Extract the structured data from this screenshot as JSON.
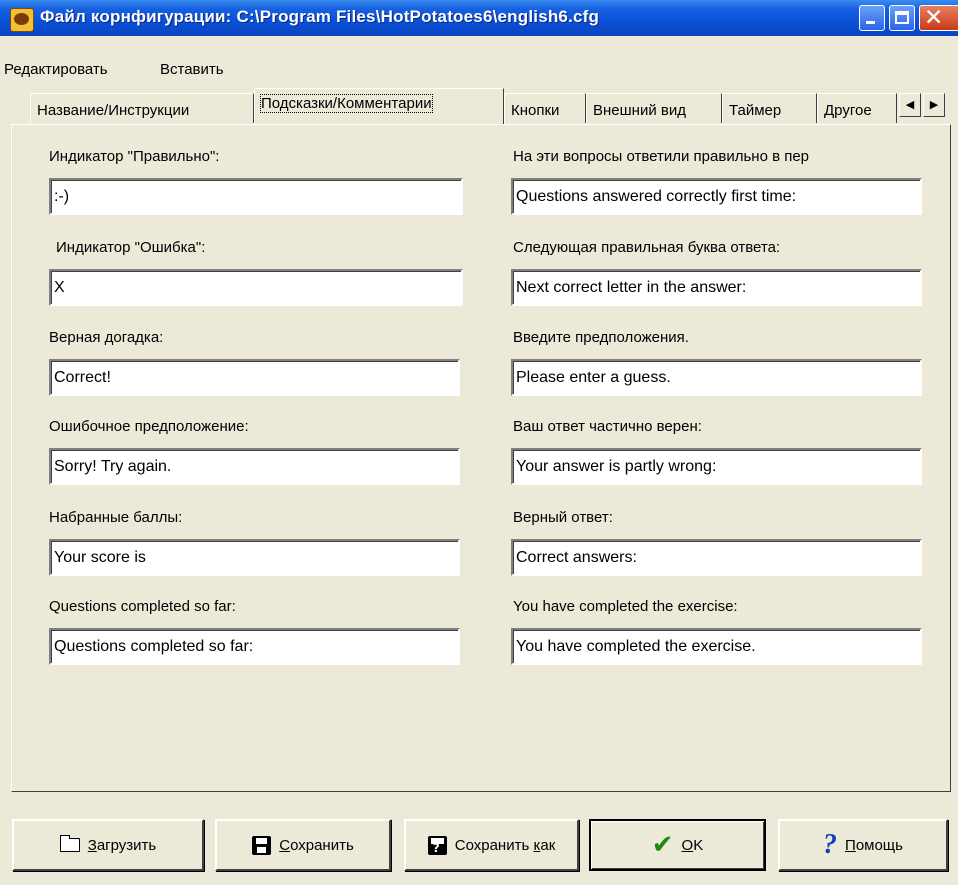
{
  "window": {
    "title": "Файл корнфигурации: C:\\Program Files\\HotPotatoes6\\english6.cfg"
  },
  "menu": {
    "items": [
      "Редактировать",
      "Вставить"
    ]
  },
  "tabs": [
    {
      "label": "Название/Инструкции",
      "active": false
    },
    {
      "label": "Подсказки/Комментарии",
      "active": true
    },
    {
      "label": "Кнопки",
      "active": false
    },
    {
      "label": "Внешний вид",
      "active": false
    },
    {
      "label": "Таймер",
      "active": false
    },
    {
      "label": "Другое",
      "active": false
    }
  ],
  "tab_scroll": {
    "left": "◀",
    "right": "▶"
  },
  "fields": {
    "correct_indicator": {
      "label": "Индикатор \"Правильно\":",
      "value": ":-)"
    },
    "error_indicator": {
      "label": "Индикатор \"Ошибка\":",
      "value": "X"
    },
    "correct_guess": {
      "label": "Верная догадка:",
      "value": "Correct!"
    },
    "wrong_guess": {
      "label": "Ошибочное предположение:",
      "value": "Sorry! Try again."
    },
    "score": {
      "label": "Набранные баллы:",
      "value": "Your score is"
    },
    "questions_completed": {
      "label": "Questions completed so far:",
      "value": "Questions completed so far:"
    },
    "first_time_correct": {
      "label": "На эти вопросы ответили правильно в пер",
      "value": "Questions answered correctly first time:"
    },
    "next_letter": {
      "label": "Следующая правильная буква ответа:",
      "value": "Next correct letter in the answer:"
    },
    "enter_guess": {
      "label": "Введите предположения.",
      "value": "Please enter a guess."
    },
    "partly_correct": {
      "label": "Ваш ответ частично верен:",
      "value": "Your answer is partly wrong:"
    },
    "correct_answer": {
      "label": "Верный ответ:",
      "value": "Correct answers:"
    },
    "exercise_completed": {
      "label": "You have completed the exercise:",
      "value": "You have completed the exercise."
    }
  },
  "buttons": {
    "load": {
      "label_u": "З",
      "label_rest": "агрузить"
    },
    "save": {
      "label_u": "С",
      "label_rest": "охранить"
    },
    "save_as": {
      "label_pre": "Сохранить ",
      "label_u": "к",
      "label_rest": "ак"
    },
    "ok": {
      "label_u": "O",
      "label_rest": "K"
    },
    "help": {
      "label_u": "П",
      "label_rest": "омощь"
    }
  }
}
